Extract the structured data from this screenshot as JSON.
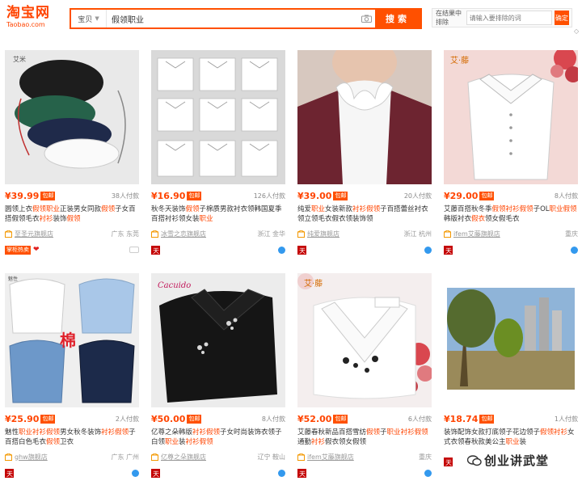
{
  "header": {
    "logo_main": "淘宝网",
    "logo_sub": "Taobao.com",
    "search_scope": "宝贝",
    "search_query": "假领职业",
    "search_button": "搜索",
    "filter_label": "在结果中排除",
    "filter_placeholder": "请输入要排除的词",
    "filter_button": "确定"
  },
  "products": [
    {
      "price": "¥39.99",
      "baoyou": "包邮",
      "sales": "38人付款",
      "title_parts": [
        {
          "t": "圆领上衣",
          "h": false
        },
        {
          "t": "假领",
          "h": true
        },
        {
          "t": "职业",
          "h": true
        },
        {
          "t": "正装男女同款",
          "h": false
        },
        {
          "t": "假领",
          "h": true
        },
        {
          "t": "子女百搭假领毛衣",
          "h": false
        },
        {
          "t": "衬衫",
          "h": true
        },
        {
          "t": "装饰",
          "h": false
        },
        {
          "t": "假领",
          "h": true
        }
      ],
      "shop": "至圣元旗舰店",
      "location": "广东 东莞",
      "badges": [
        "tmall",
        "promo:掌柜热卖",
        "heart",
        "gray"
      ]
    },
    {
      "price": "¥16.90",
      "baoyou": "包邮",
      "sales": "126人付款",
      "title_parts": [
        {
          "t": "秋冬天装饰",
          "h": false
        },
        {
          "t": "假领",
          "h": true
        },
        {
          "t": "子棉质男款衬衣领韩国夏季百搭衬衫领女装",
          "h": false
        },
        {
          "t": "职业",
          "h": true
        }
      ],
      "shop": "冰雪之恋旗舰店",
      "location": "浙江 金华",
      "badges": [
        "tmall",
        "circle"
      ]
    },
    {
      "price": "¥39.00",
      "baoyou": "包邮",
      "sales": "20人付款",
      "title_parts": [
        {
          "t": "纯爱",
          "h": false
        },
        {
          "t": "职业",
          "h": true
        },
        {
          "t": "女装新款",
          "h": false
        },
        {
          "t": "衬衫",
          "h": true
        },
        {
          "t": "假领",
          "h": true
        },
        {
          "t": "子百搭蕾丝衬衣领立领毛衣假衣领装饰领",
          "h": false
        }
      ],
      "shop": "纯爱旗舰店",
      "location": "浙江 杭州",
      "badges": [
        "tmall",
        "circle"
      ]
    },
    {
      "price": "¥29.00",
      "baoyou": "包邮",
      "sales": "8人付款",
      "title_parts": [
        {
          "t": "艾藤百搭秋冬季",
          "h": false
        },
        {
          "t": "假领",
          "h": true
        },
        {
          "t": "衬衫",
          "h": true
        },
        {
          "t": "假领",
          "h": true
        },
        {
          "t": "子OL",
          "h": false
        },
        {
          "t": "职业",
          "h": true
        },
        {
          "t": "假领",
          "h": true
        },
        {
          "t": "韩版衬衣",
          "h": false
        },
        {
          "t": "假衣",
          "h": true
        },
        {
          "t": "领女假毛衣",
          "h": false
        }
      ],
      "shop": "ifem艾藤旗舰店",
      "location": "重庆",
      "badges": [
        "tmall",
        "circle"
      ]
    },
    {
      "price": "¥25.90",
      "baoyou": "包邮",
      "sales": "2人付款",
      "title_parts": [
        {
          "t": "魅性",
          "h": false
        },
        {
          "t": "职业",
          "h": true
        },
        {
          "t": "衬衫",
          "h": true
        },
        {
          "t": "假领",
          "h": true
        },
        {
          "t": "男女秋冬装饰",
          "h": false
        },
        {
          "t": "衬衫",
          "h": true
        },
        {
          "t": "假领",
          "h": true
        },
        {
          "t": "子百搭白色毛衣",
          "h": false
        },
        {
          "t": "假领",
          "h": true
        },
        {
          "t": "卫衣",
          "h": false
        }
      ],
      "shop": "ghw旗舰店",
      "location": "广东 广州",
      "badges": [
        "tmall",
        "circle"
      ]
    },
    {
      "price": "¥50.00",
      "baoyou": "包邮",
      "sales": "8人付款",
      "title_parts": [
        {
          "t": "亿尊之朵韩版",
          "h": false
        },
        {
          "t": "衬衫",
          "h": true
        },
        {
          "t": "假领",
          "h": true
        },
        {
          "t": "子女时尚装饰衣领子 白领",
          "h": false
        },
        {
          "t": "职业",
          "h": true
        },
        {
          "t": "装",
          "h": false
        },
        {
          "t": "衬衫",
          "h": true
        },
        {
          "t": "假领",
          "h": true
        }
      ],
      "shop": "亿尊之朵旗舰店",
      "location": "辽宁 鞍山",
      "badges": [
        "tmall",
        "circle"
      ]
    },
    {
      "price": "¥52.00",
      "baoyou": "包邮",
      "sales": "6人付款",
      "title_parts": [
        {
          "t": "艾藤春秋新品百搭雪纺",
          "h": false
        },
        {
          "t": "假领",
          "h": true
        },
        {
          "t": "子",
          "h": false
        },
        {
          "t": "职业",
          "h": true
        },
        {
          "t": "衬衫",
          "h": true
        },
        {
          "t": "假领",
          "h": true
        },
        {
          "t": "通勤",
          "h": false
        },
        {
          "t": "衬衫",
          "h": true
        },
        {
          "t": "假衣领女假领",
          "h": false
        }
      ],
      "shop": "ifem艾藤旗舰店",
      "location": "重庆",
      "badges": [
        "tmall",
        "circle"
      ]
    },
    {
      "price": "¥18.74",
      "baoyou": "包邮",
      "sales": "1人付款",
      "title_parts": [
        {
          "t": "装饰配饰女款打底领子花边领子",
          "h": false
        },
        {
          "t": "假领",
          "h": true
        },
        {
          "t": "衬衫",
          "h": true
        },
        {
          "t": "女式衣领春秋款美公主",
          "h": false
        },
        {
          "t": "职业",
          "h": true
        },
        {
          "t": "装",
          "h": false
        }
      ],
      "shop": "",
      "location": "",
      "badges": [
        "tmall"
      ]
    }
  ],
  "watermark": "创业讲武堂",
  "colors": {
    "accent": "#ff5000",
    "price": "#ff4400"
  }
}
